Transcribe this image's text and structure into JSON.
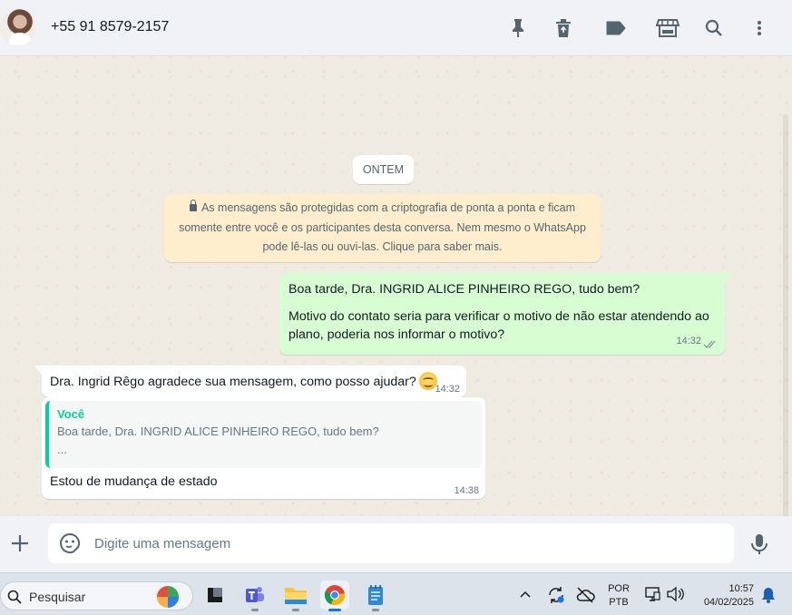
{
  "header": {
    "contact_name": "+55 91 8579-2157",
    "icons": [
      "pin-icon",
      "delete-icon",
      "label-icon",
      "store-icon",
      "search-icon",
      "menu-icon"
    ]
  },
  "chat": {
    "date_chip": "ONTEM",
    "encryption_notice": {
      "line1": "As mensagens são protegidas com a criptografia de ponta a ponta e ficam",
      "line2": "somente entre você e os participantes desta conversa. Nem mesmo o WhatsApp",
      "line3": "pode lê-las ou ouvi-las. Clique para saber mais."
    },
    "messages": [
      {
        "direction": "outgoing",
        "line1": "Boa tarde, Dra. INGRID ALICE PINHEIRO REGO, tudo bem?",
        "line2": "Motivo do contato seria para verificar o motivo de não estar atendendo ao",
        "line3": "plano, poderia nos informar o motivo?",
        "time": "14:32",
        "status": "read"
      },
      {
        "direction": "incoming",
        "text": "Dra. Ingrid Rêgo agradece sua mensagem, como posso ajudar?",
        "emoji": "smiling-face-icon",
        "time": "14:32"
      },
      {
        "direction": "incoming",
        "quote_author": "Você",
        "quote_text": "Boa tarde, Dra. INGRID ALICE PINHEIRO REGO, tudo bem?",
        "quote_more": "...",
        "text": "Estou de mudança de estado",
        "time": "14:38"
      }
    ]
  },
  "composer": {
    "placeholder": "Digite uma mensagem"
  },
  "taskbar": {
    "search_placeholder": "Pesquisar",
    "apps": [
      "desktop-icon",
      "teams-icon",
      "file-explorer-icon",
      "chrome-icon",
      "notepad-icon"
    ],
    "language_top": "POR",
    "language_bottom": "PTB",
    "time": "10:57",
    "date": "04/02/2025"
  },
  "colors": {
    "accent": "#06cf9c",
    "outgoing_bubble": "#d9fdd3",
    "incoming_bubble": "#ffffff",
    "chat_background": "#efeae2",
    "notice_background": "#ffeecd"
  }
}
